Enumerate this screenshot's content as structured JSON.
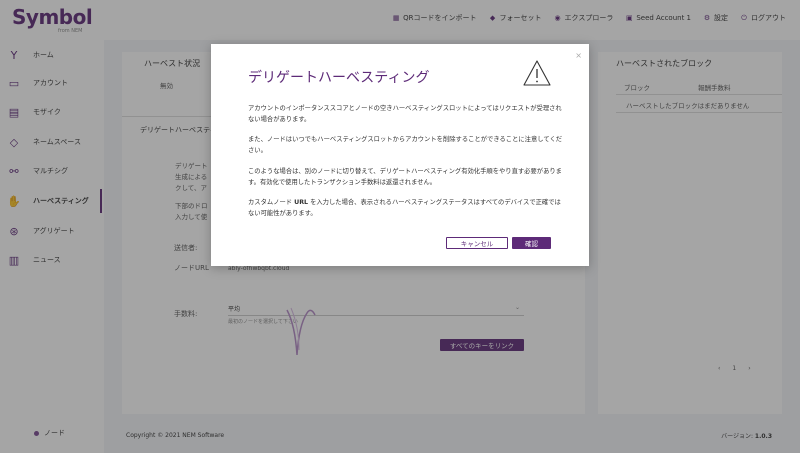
{
  "brand": {
    "name": "Symbol",
    "sub": "from NEM"
  },
  "topnav": [
    {
      "icon": "qr-icon",
      "label": "QRコードをインポート"
    },
    {
      "icon": "faucet-icon",
      "label": "フォーセット"
    },
    {
      "icon": "explorer-icon",
      "label": "エクスプローラ"
    },
    {
      "icon": "account-icon",
      "label": "Seed Account 1"
    },
    {
      "icon": "gear-icon",
      "label": "設定"
    },
    {
      "icon": "logout-icon",
      "label": "ログアウト"
    }
  ],
  "sidebar": {
    "items": [
      {
        "icon": "home-icon",
        "label": "ホーム"
      },
      {
        "icon": "account-icon",
        "label": "アカウント"
      },
      {
        "icon": "mosaic-icon",
        "label": "モザイク"
      },
      {
        "icon": "namespace-icon",
        "label": "ネームスペース"
      },
      {
        "icon": "multisig-icon",
        "label": "マルチシグ"
      },
      {
        "icon": "harvesting-icon",
        "label": "ハーベスティング"
      },
      {
        "icon": "aggregate-icon",
        "label": "アグリゲート"
      },
      {
        "icon": "news-icon",
        "label": "ニュース"
      }
    ],
    "active_index": 5,
    "node_label": "ノード"
  },
  "main": {
    "harvest_status_title": "ハーベスト状況",
    "harvest_status_value": "無効",
    "delegated_title": "デリゲートハーベスティ",
    "desc_line1": "デリゲート",
    "desc_line2": "生成による",
    "desc_line3": "クして、ア",
    "desc_line4": "下部のドロ",
    "desc_line5": "入力して使",
    "sender_label": "送信者:",
    "node_url_label": "ノードURL",
    "node_url_value": "ably-ofhwbqbt.cloud",
    "fee_label": "手数料:",
    "fee_value": "平均",
    "fee_note": "最初のノードを選択して下さい",
    "link_all_keys": "すべてのキーをリンク"
  },
  "right": {
    "title": "ハーベストされたブロック",
    "col_block": "ブロック",
    "col_fee": "報酬手数料",
    "empty": "ハーベストしたブロックはまだありません",
    "page": "1"
  },
  "footer": {
    "copyright": "Copyright © 2021 NEM Software",
    "version_label": "バージョン:",
    "version": "1.0.3"
  },
  "modal": {
    "title": "デリゲートハーベスティング",
    "p1": "アカウントのインポータンススコアとノードの空きハーベスティングスロットによってはリクエストが受理されない場合があります。",
    "p2": "また、ノードはいつでもハーベスティングスロットからアカウントを削除することができることに注意してください。",
    "p3": "このような場合は、別のノードに切り替えて、デリゲートハーベスティング有効化手順をやり直す必要があります。有効化で使用したトランザクション手数料は返還されません。",
    "p4_pre": "カスタムノード ",
    "p4_bold": "URL",
    "p4_post": " を入力した場合、表示されるハーベスティングステータスはすべてのデバイスで正確ではない可能性があります。",
    "cancel": "キャンセル",
    "confirm": "確認",
    "close": "×"
  },
  "colors": {
    "brand": "#5d2a78",
    "overlay": "rgba(40,40,40,0.42)"
  }
}
